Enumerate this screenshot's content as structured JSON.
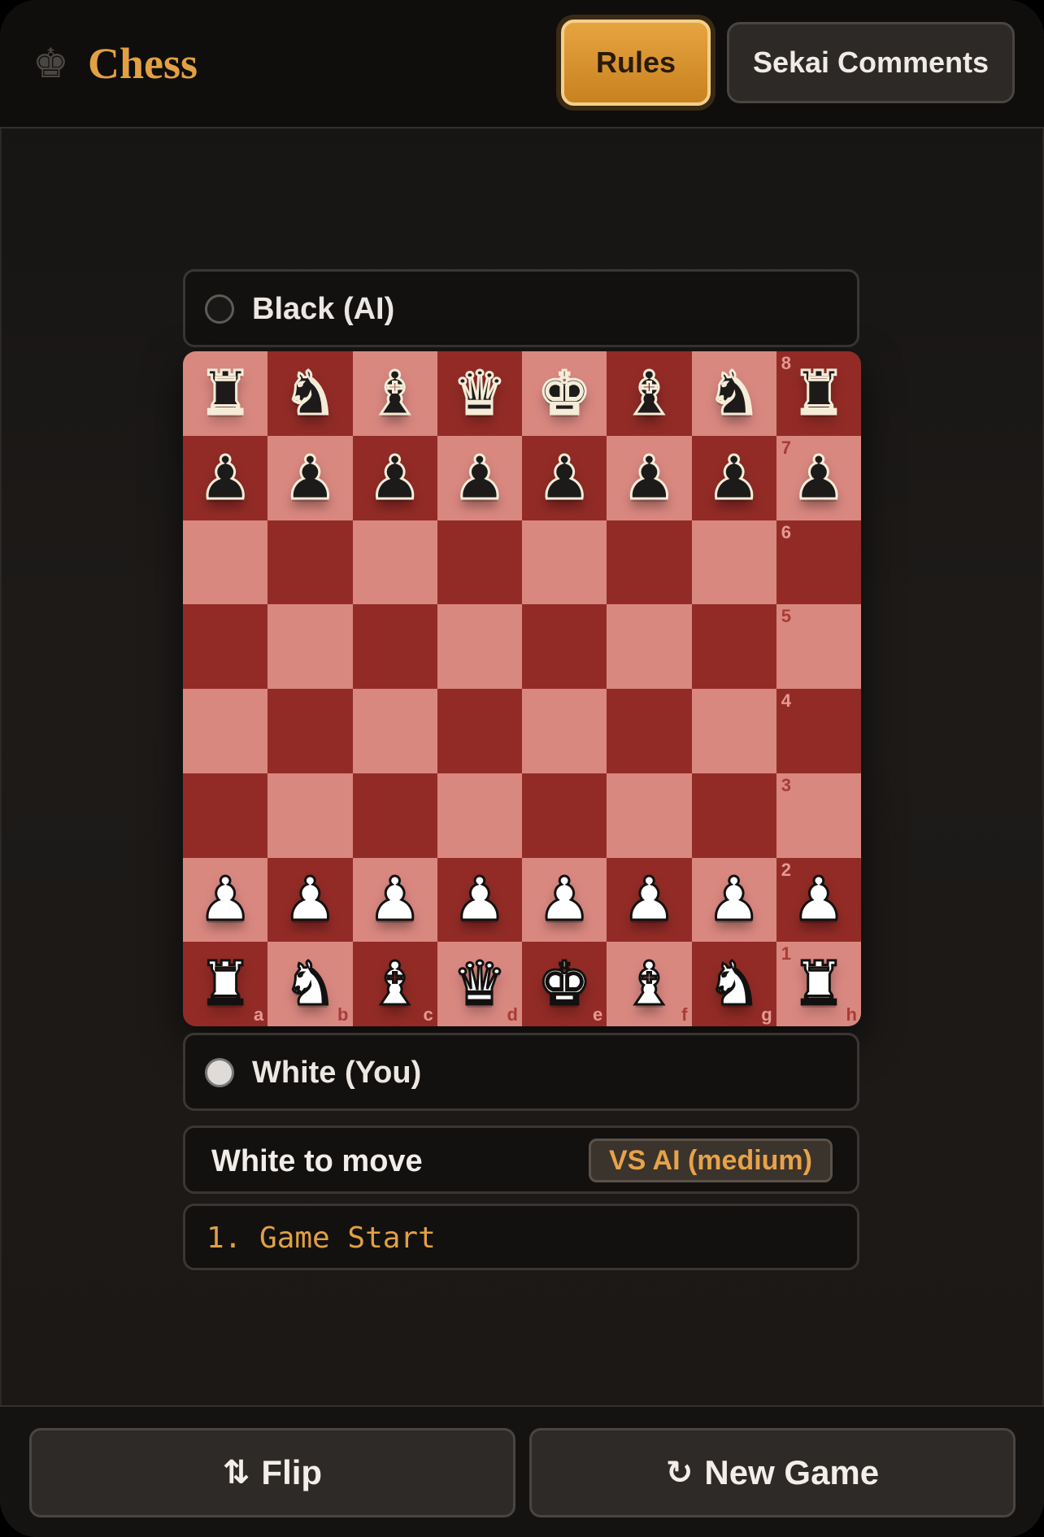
{
  "header": {
    "logo_icon": "♚",
    "title": "Chess",
    "rules_label": "Rules",
    "sekai_label": "Sekai Comments"
  },
  "players": {
    "top": {
      "name": "Black (AI)",
      "indicator": "inactive"
    },
    "bottom": {
      "name": "White (You)",
      "indicator": "inactive"
    }
  },
  "board": {
    "rows": [
      [
        "bR",
        "bN",
        "bB",
        "bQ",
        "bK",
        "bB",
        "bN",
        "bR"
      ],
      [
        "bP",
        "bP",
        "bP",
        "bP",
        "bP",
        "bP",
        "bP",
        "bP"
      ],
      [
        "",
        "",
        "",
        "",
        "",
        "",
        "",
        ""
      ],
      [
        "",
        "",
        "",
        "",
        "",
        "",
        "",
        ""
      ],
      [
        "",
        "",
        "",
        "",
        "",
        "",
        "",
        ""
      ],
      [
        "",
        "",
        "",
        "",
        "",
        "",
        "",
        ""
      ],
      [
        "wP",
        "wP",
        "wP",
        "wP",
        "wP",
        "wP",
        "wP",
        "wP"
      ],
      [
        "wR",
        "wN",
        "wB",
        "wQ",
        "wK",
        "wB",
        "wN",
        "wR"
      ]
    ],
    "rank_labels": [
      "8",
      "7",
      "6",
      "5",
      "4",
      "3",
      "2",
      "1"
    ],
    "file_labels": [
      "a",
      "b",
      "c",
      "d",
      "e",
      "f",
      "g",
      "h"
    ],
    "colors": {
      "light": "#d98880",
      "dark": "#922b26"
    }
  },
  "status": {
    "text": "White to move",
    "mode": "VS AI (medium)"
  },
  "moves": {
    "text": "1. Game Start"
  },
  "footer": {
    "flip_icon": "⇅",
    "flip_label": "Flip",
    "new_game_icon": "↻",
    "new_game_label": "New Game"
  },
  "accent_color": "#e2a043"
}
